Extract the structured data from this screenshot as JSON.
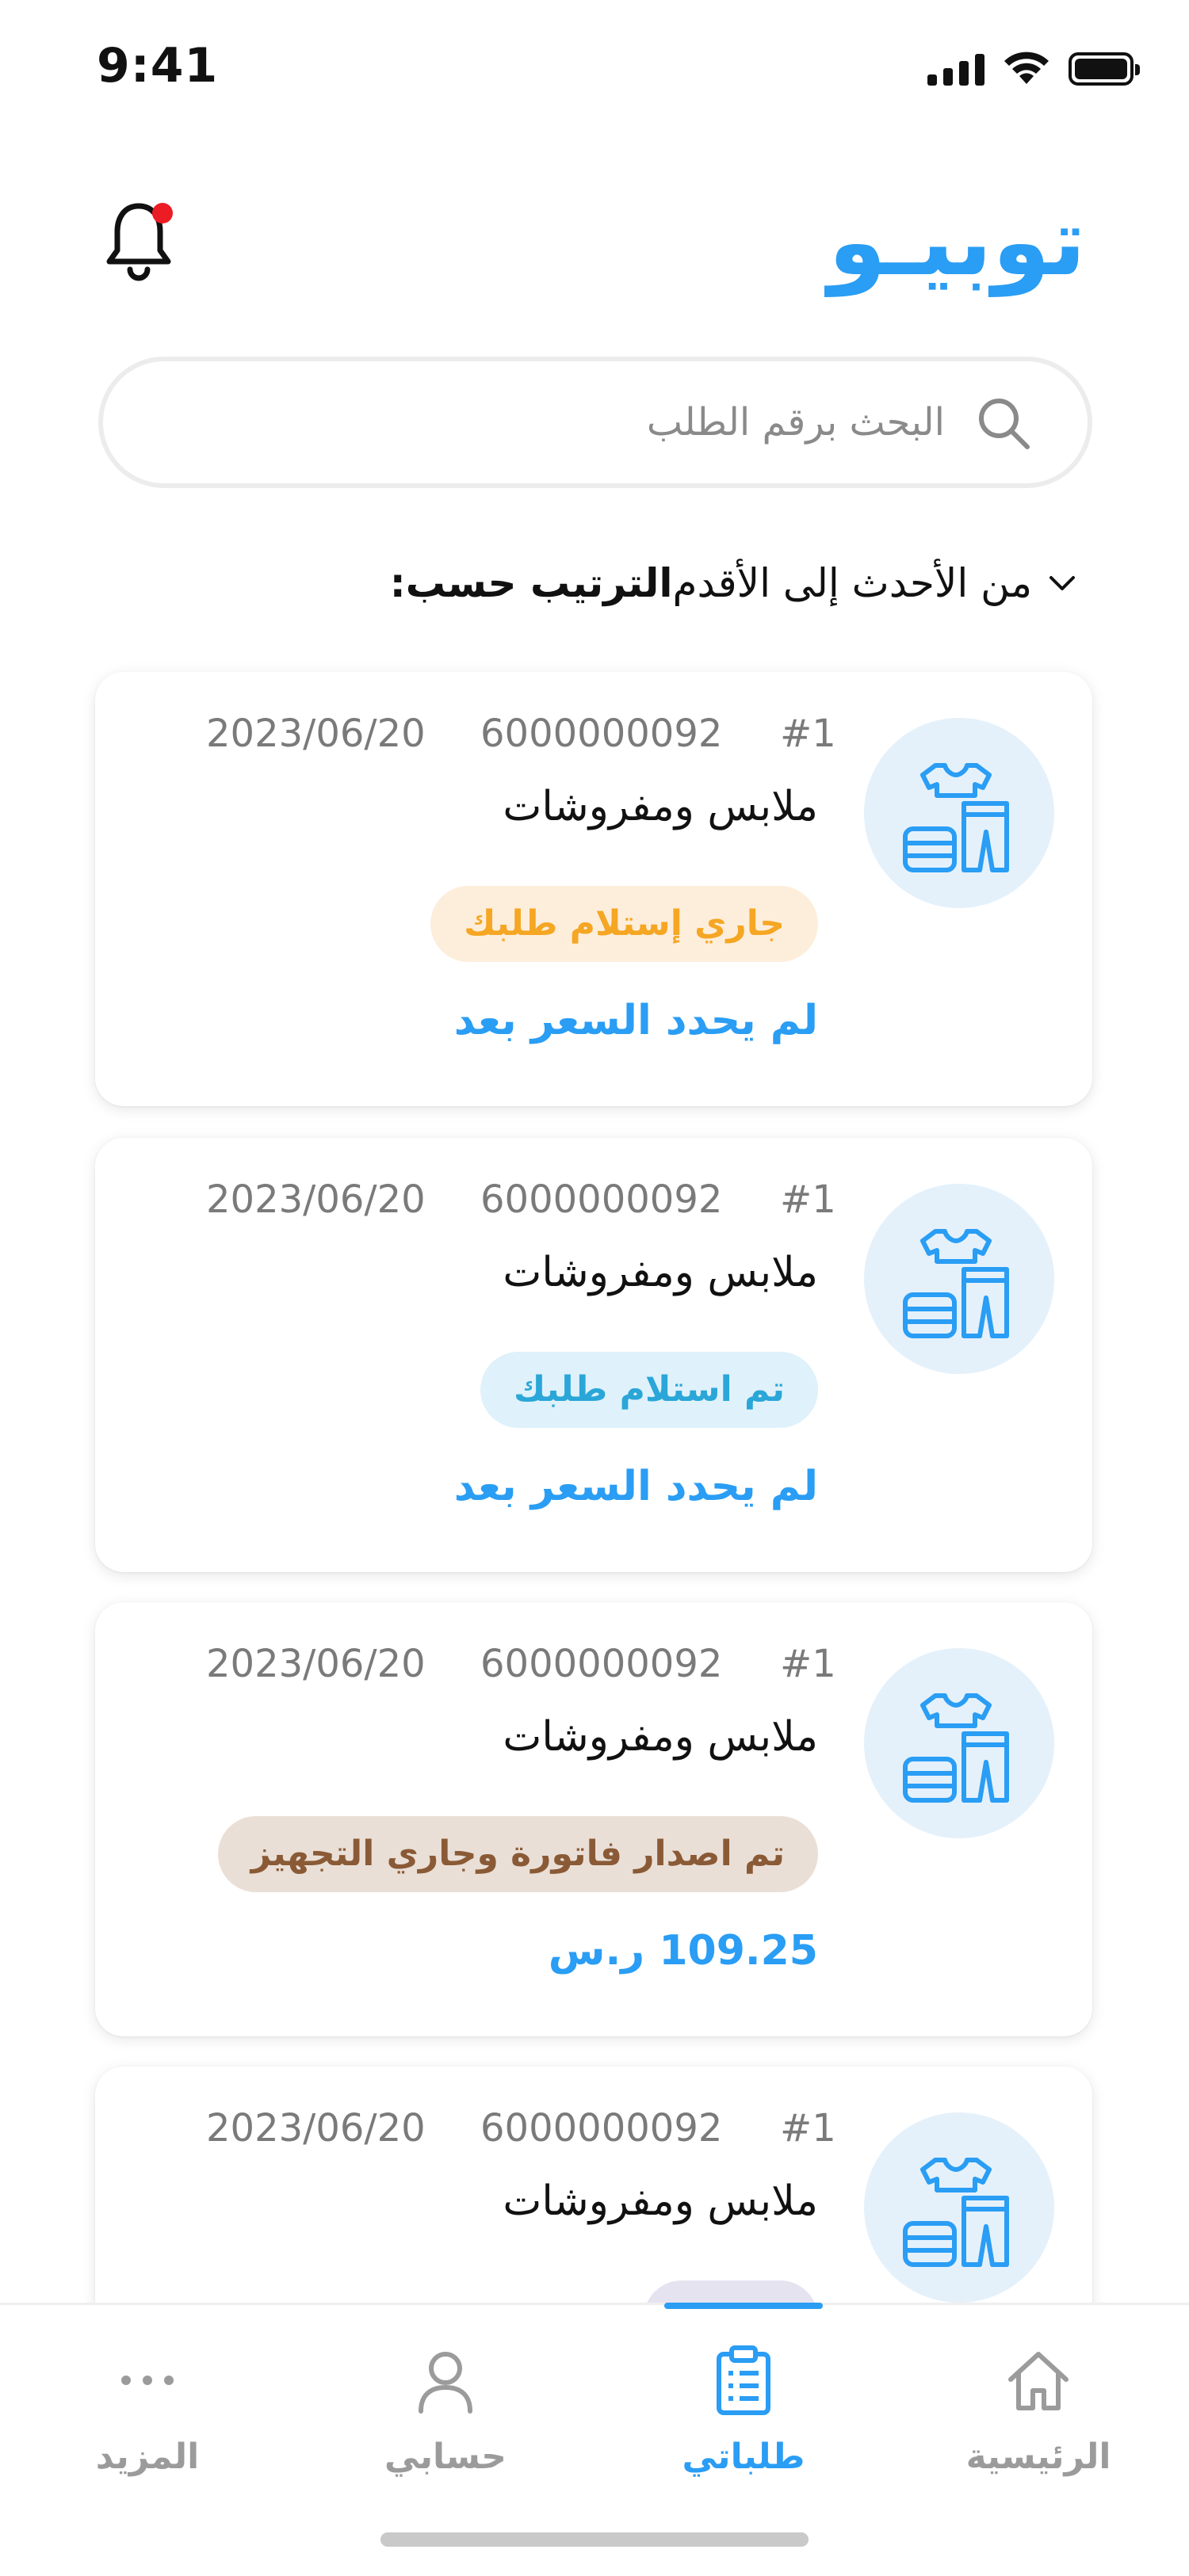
{
  "status_bar": {
    "time": "9:41"
  },
  "header": {
    "logo_text": "توبيـو"
  },
  "search": {
    "placeholder": "البحث برقم الطلب"
  },
  "sort": {
    "label": "الترتيب حسب:",
    "value": "من الأحدث إلى الأقدم"
  },
  "orders": [
    {
      "index": "#1",
      "order_number": "6000000092",
      "date": "2023/06/20",
      "category": "ملابس ومفروشات",
      "status": "جاري إستلام طلبك",
      "price": "لم يحدد السعر بعد",
      "status_color": "#f5a623"
    },
    {
      "index": "#1",
      "order_number": "6000000092",
      "date": "2023/06/20",
      "category": "ملابس ومفروشات",
      "status": "تم استلام طلبك",
      "price": "لم يحدد السعر بعد",
      "status_color": "#2aa6d8"
    },
    {
      "index": "#1",
      "order_number": "6000000092",
      "date": "2023/06/20",
      "category": "ملابس ومفروشات",
      "status": "تم اصدار فاتورة وجاري التجهيز",
      "price": "109.25 ر.س",
      "status_color": "#8a5a36"
    },
    {
      "index": "#1",
      "order_number": "6000000092",
      "date": "2023/06/20",
      "category": "ملابس ومفروشات",
      "status": "",
      "price": "",
      "status_color": "#d8d4ea"
    }
  ],
  "bottom_nav": {
    "items": [
      {
        "label": "الرئيسية",
        "icon": "home-icon"
      },
      {
        "label": "طلباتي",
        "icon": "clipboard-icon"
      },
      {
        "label": "حسابي",
        "icon": "user-icon"
      },
      {
        "label": "المزيد",
        "icon": "more-icon"
      }
    ],
    "active_index": 1
  },
  "colors": {
    "accent": "#2a9df4",
    "notification_dot": "#ec1c24"
  }
}
